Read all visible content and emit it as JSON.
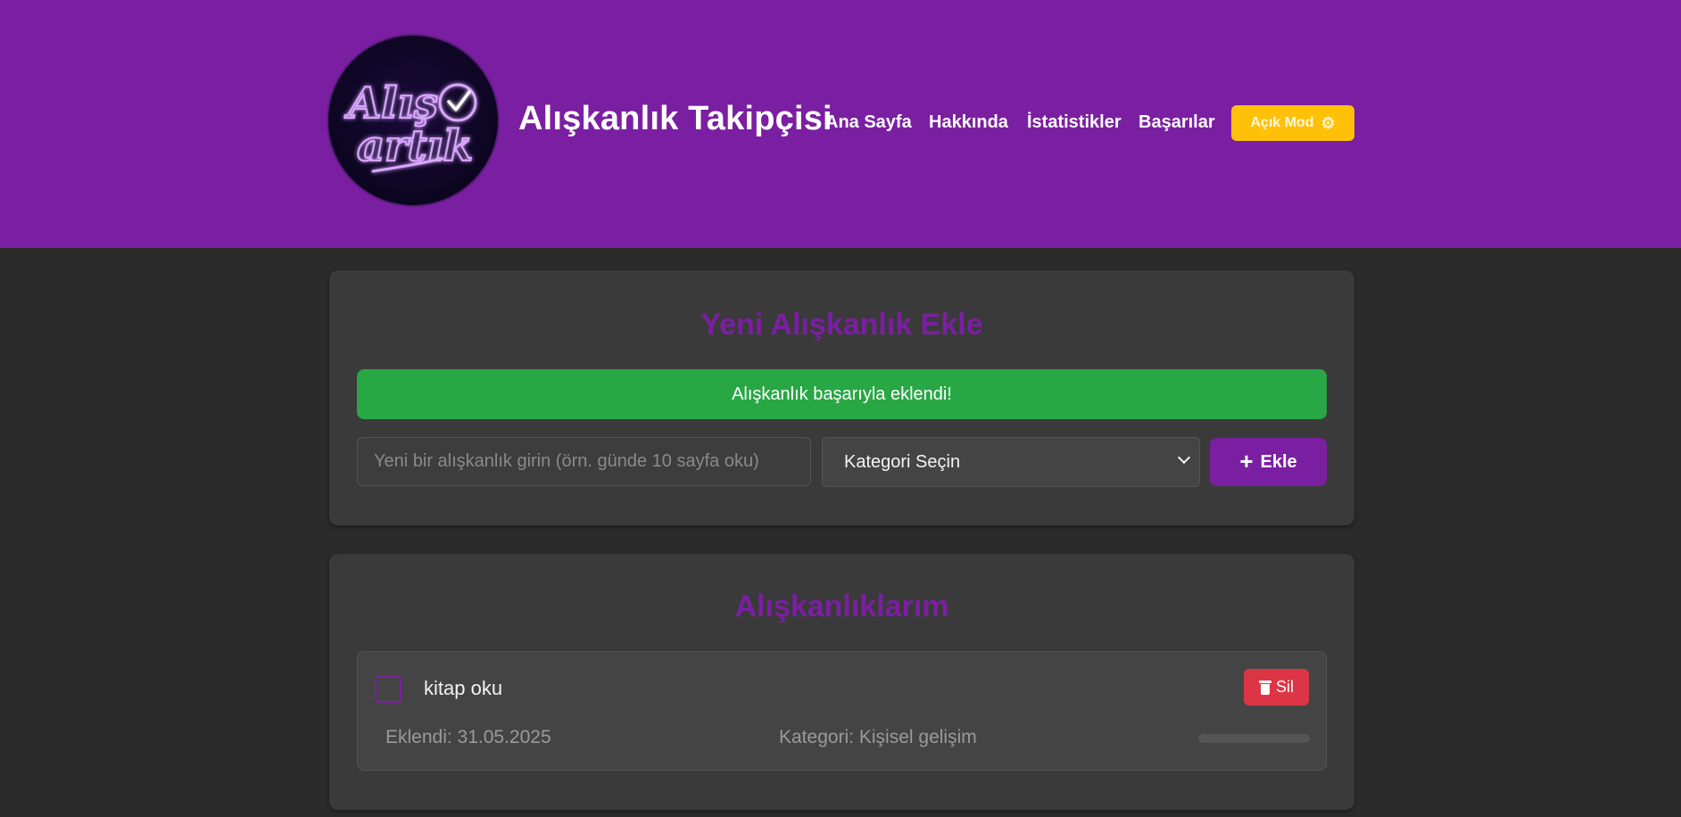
{
  "header": {
    "logo_text_line1": "Alış",
    "logo_text_line2": "artık",
    "title": "Alışkanlık Takipçisi",
    "nav": [
      "Ana Sayfa",
      "Hakkında",
      "İstatistikler",
      "Başarılar"
    ],
    "mode_button_label": "Açık Mod",
    "mode_button_icon": "gear-icon"
  },
  "add_section": {
    "title": "Yeni Alışkanlık Ekle",
    "alert": "Alışkanlık başarıyla eklendi!",
    "input_placeholder": "Yeni bir alışkanlık girin (örn. günde 10 sayfa oku)",
    "input_value": "",
    "category_selected": "Kategori Seçin",
    "add_button_label": "Ekle"
  },
  "habits_section": {
    "title": "Alışkanlıklarım",
    "items": [
      {
        "name": "kitap oku",
        "checked": false,
        "delete_label": "Sil",
        "added": "Eklendi: 31.05.2025",
        "category": "Kategori: Kişisel gelişim",
        "progress": 0
      }
    ]
  },
  "colors": {
    "primary": "#7b1fa2",
    "background": "#2b2b2b",
    "card": "#3a3a3a",
    "success": "#28a745",
    "danger": "#dc3545",
    "warning": "#ffc107"
  }
}
